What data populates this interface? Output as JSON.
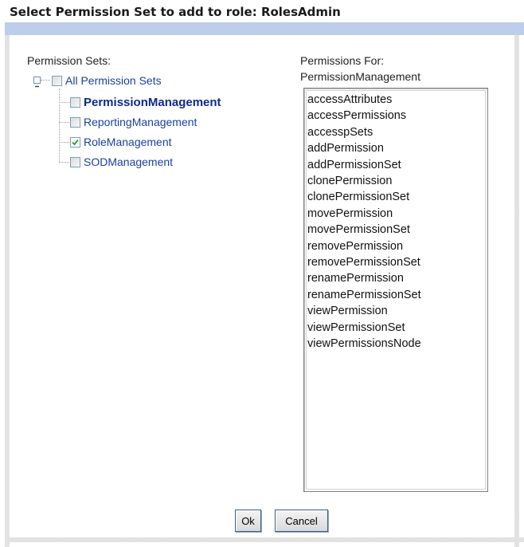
{
  "dialog": {
    "title": "Select Permission Set to add to role: RolesAdmin"
  },
  "permission_sets": {
    "label": "Permission Sets:",
    "root": {
      "label": "All Permission Sets",
      "checked": false,
      "expanded": true,
      "expander_icon": "minus-icon"
    },
    "children": [
      {
        "label": "PermissionManagement",
        "checked": false,
        "selected": true
      },
      {
        "label": "ReportingManagement",
        "checked": false,
        "selected": false
      },
      {
        "label": "RoleManagement",
        "checked": true,
        "selected": false
      },
      {
        "label": "SODManagement",
        "checked": false,
        "selected": false
      }
    ]
  },
  "permissions": {
    "label_line1": "Permissions For:",
    "label_line2": "PermissionManagement",
    "items": [
      "accessAttributes",
      "accessPermissions",
      "accesspSets",
      "addPermission",
      "addPermissionSet",
      "clonePermission",
      "clonePermissionSet",
      "movePermission",
      "movePermissionSet",
      "removePermission",
      "removePermissionSet",
      "renamePermission",
      "renamePermissionSet",
      "viewPermission",
      "viewPermissionSet",
      "viewPermissionsNode"
    ]
  },
  "buttons": {
    "ok": "Ok",
    "cancel": "Cancel"
  },
  "colors": {
    "header_band": "#c5d3ee",
    "link_text": "#1a3fa0",
    "checkbox_border": "#7f9db9",
    "check_mark": "#21a121"
  }
}
